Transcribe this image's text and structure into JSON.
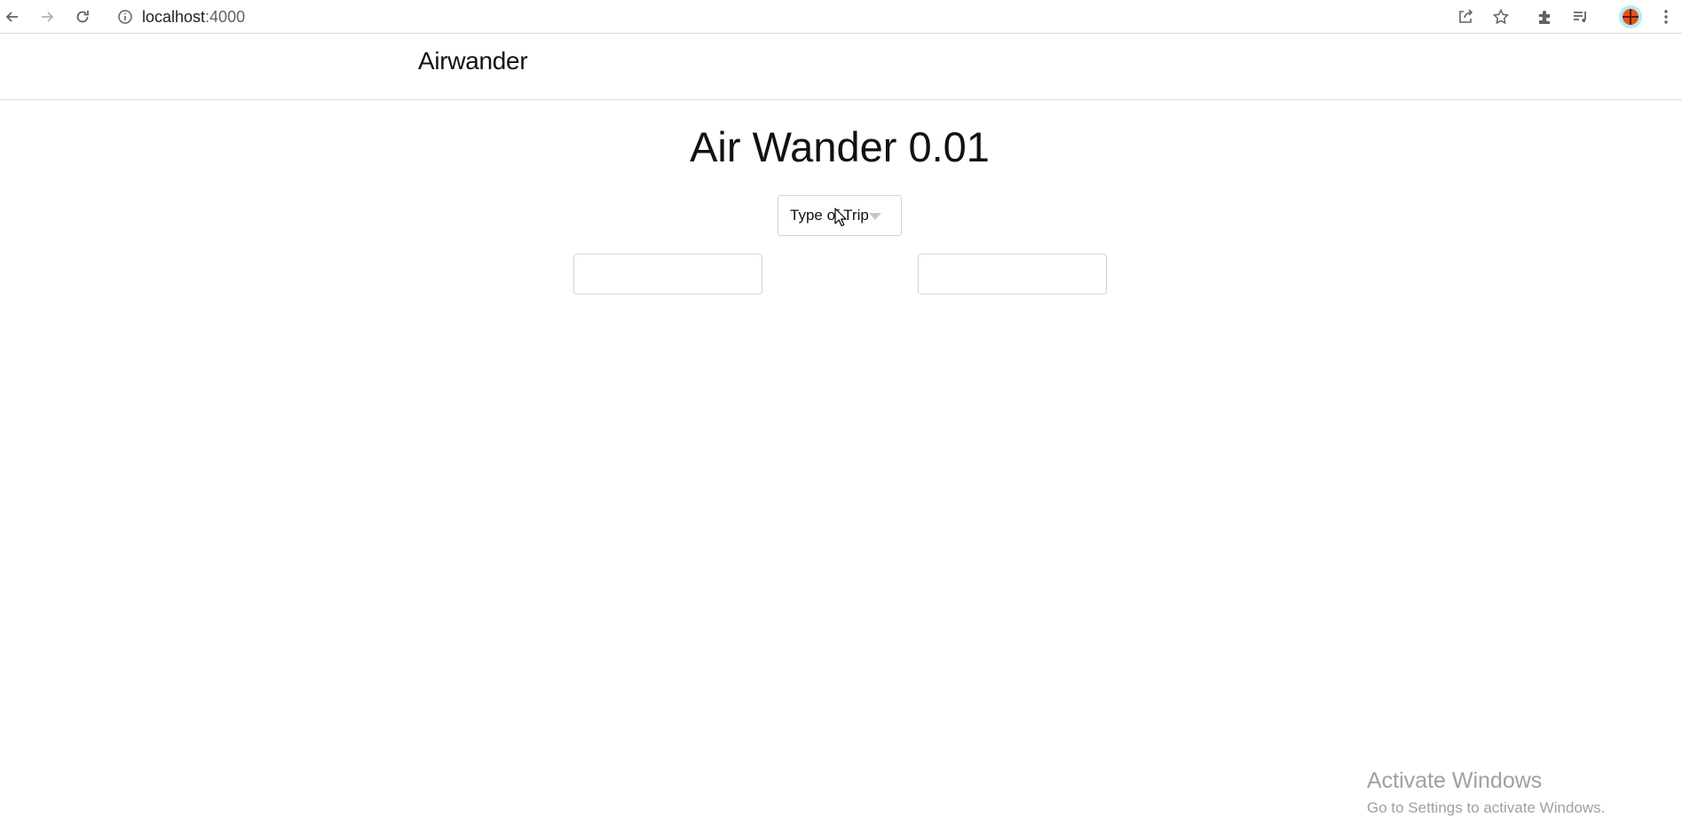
{
  "browser": {
    "url_host": "localhost",
    "url_port": ":4000",
    "back_icon": "arrow-left-icon",
    "forward_icon": "arrow-right-icon",
    "reload_icon": "reload-icon",
    "info_icon": "info-icon",
    "share_icon": "share-icon",
    "bookmark_icon": "star-icon",
    "extensions_icon": "puzzle-icon",
    "media_icon": "playlist-icon",
    "profile_icon": "basketball-avatar-icon",
    "menu_icon": "kebab-menu-icon"
  },
  "app": {
    "brand": "Airwander",
    "title": "Air Wander 0.01",
    "trip_select": {
      "selected_label": "Type of Trip"
    },
    "field_left": {
      "value": "",
      "placeholder": ""
    },
    "field_right": {
      "value": "",
      "placeholder": ""
    }
  },
  "os_watermark": {
    "title": "Activate Windows",
    "subtitle": "Go to Settings to activate Windows."
  },
  "colors": {
    "border": "#d4d4d4",
    "caret": "#c8c8c8",
    "watermark": "#a0a0a0",
    "avatar_bg": "#b4ebf2",
    "avatar_ball": "#e8501f"
  }
}
